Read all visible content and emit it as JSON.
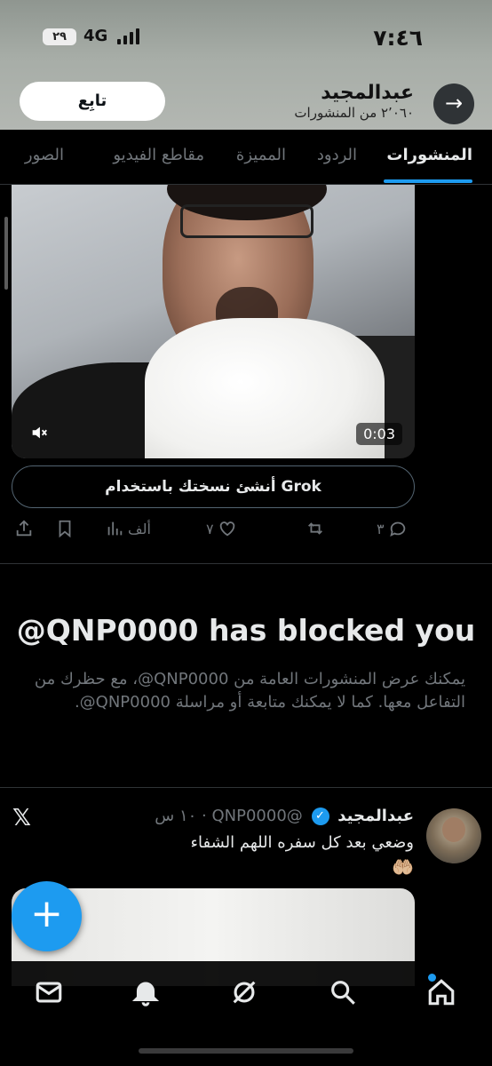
{
  "status_bar": {
    "time": "٧:٤٦",
    "network": "4G",
    "battery": "٢٩"
  },
  "header": {
    "follow_label": "تابِع",
    "profile_name": "عبدالمجيد",
    "post_count": "٢٬٠٦٠ من المنشورات",
    "back_icon": "arrow-right-icon"
  },
  "tabs": [
    {
      "label": "المنشورات",
      "active": true
    },
    {
      "label": "الردود",
      "active": false
    },
    {
      "label": "المميزة",
      "active": false
    },
    {
      "label": "مقاطع الفيديو",
      "active": false
    },
    {
      "label": "الصور",
      "active": false
    }
  ],
  "video_post": {
    "duration": "0:03",
    "grok_button": "أنشئ نسختك باستخدام Grok",
    "actions": {
      "replies": "٣",
      "reposts": "",
      "likes": "٧",
      "views": "ألف",
      "bookmark_icon": "bookmark-icon",
      "share_icon": "share-icon"
    }
  },
  "blocked_notice": {
    "title": "@QNP0000 has blocked you",
    "body": "يمكنك عرض المنشورات العامة من ‎@QNP0000، مع حظرك من التفاعل معها. كما لا يمكنك متابعة أو مراسلة ‎@QNP0000."
  },
  "tweet": {
    "name": "عبدالمجيد",
    "handle": "@QNP0000",
    "time": "١٠ س",
    "text": "وضعي بعد كل سفره اللهم الشفاء",
    "emoji": "🤲🏼"
  },
  "fab_label": "+",
  "bottom_nav": [
    "home-icon",
    "search-icon",
    "grok-icon",
    "notifications-icon",
    "messages-icon"
  ],
  "colors": {
    "accent": "#1d9bf0",
    "background": "#000000",
    "secondary_text": "#71767b"
  }
}
